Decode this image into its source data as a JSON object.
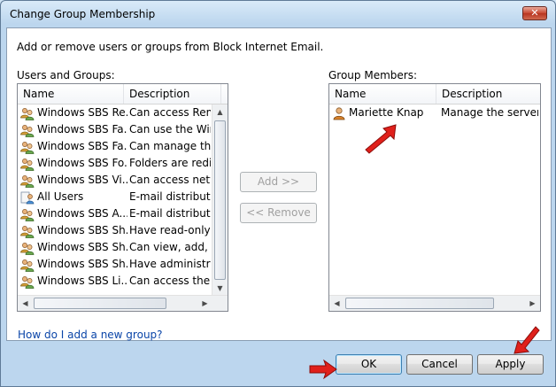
{
  "window": {
    "title": "Change Group Membership",
    "close_glyph": "✕"
  },
  "instructions": "Add or remove users or groups from Block Internet Email.",
  "left": {
    "label": "Users and Groups:",
    "columns": [
      "Name",
      "Description"
    ],
    "rows": [
      {
        "name": "Windows SBS Re...",
        "desc": "Can access Remo",
        "icon": "group-icon"
      },
      {
        "name": "Windows SBS Fa...",
        "desc": "Can use the Winc",
        "icon": "group-icon"
      },
      {
        "name": "Windows SBS Fa...",
        "desc": "Can manage the",
        "icon": "group-icon"
      },
      {
        "name": "Windows SBS Fo...",
        "desc": "Folders are redire",
        "icon": "group-icon"
      },
      {
        "name": "Windows SBS Vi...",
        "desc": "Can access netwo",
        "icon": "group-icon"
      },
      {
        "name": "All Users",
        "desc": "E-mail distributio",
        "icon": "distribution-list-icon"
      },
      {
        "name": "Windows SBS A...",
        "desc": "E-mail distributio",
        "icon": "group-icon"
      },
      {
        "name": "Windows SBS Sh...",
        "desc": "Have read-only a",
        "icon": "group-icon"
      },
      {
        "name": "Windows SBS Sh...",
        "desc": "Can view, add, up",
        "icon": "group-icon"
      },
      {
        "name": "Windows SBS Sh...",
        "desc": "Have administrat",
        "icon": "group-icon"
      },
      {
        "name": "Windows SBS Li...",
        "desc": "Can access the Li",
        "icon": "group-icon"
      }
    ]
  },
  "buttons": {
    "add": "Add >>",
    "remove": "<< Remove",
    "ok": "OK",
    "cancel": "Cancel",
    "apply": "Apply"
  },
  "right": {
    "label": "Group Members:",
    "columns": [
      "Name",
      "Description"
    ],
    "rows": [
      {
        "name": "Mariette Knap",
        "desc": "Manage the server ar",
        "icon": "user-icon"
      }
    ]
  },
  "help_link": "How do I add a new group?",
  "colors": {
    "annotation_arrow": "#e0201b",
    "link": "#0a45a8"
  }
}
